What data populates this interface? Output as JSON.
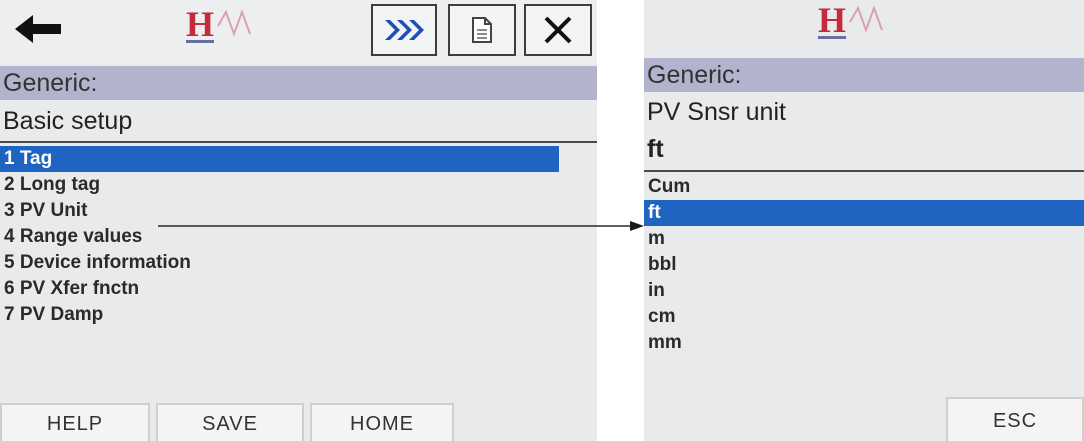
{
  "left_screen": {
    "header_band": "Generic:",
    "subtitle": "Basic setup",
    "menu_items": [
      {
        "label": "1 Tag",
        "selected": true
      },
      {
        "label": "2 Long tag",
        "selected": false
      },
      {
        "label": "3 PV Unit",
        "selected": false
      },
      {
        "label": "4 Range values",
        "selected": false
      },
      {
        "label": "5 Device information",
        "selected": false
      },
      {
        "label": "6 PV Xfer fnctn",
        "selected": false
      },
      {
        "label": "7 PV Damp",
        "selected": false
      }
    ],
    "buttons": {
      "help": "HELP",
      "save": "SAVE",
      "home": "HOME"
    },
    "icons": [
      "back-arrow-icon",
      "fast-forward-icon",
      "document-icon",
      "close-icon"
    ]
  },
  "right_screen": {
    "header_band": "Generic:",
    "variable_name": "PV Snsr unit",
    "current_value": "ft",
    "options": [
      {
        "label": "Cum",
        "selected": false
      },
      {
        "label": "ft",
        "selected": true
      },
      {
        "label": "m",
        "selected": false
      },
      {
        "label": "bbl",
        "selected": false
      },
      {
        "label": "in",
        "selected": false
      },
      {
        "label": "cm",
        "selected": false
      },
      {
        "label": "mm",
        "selected": false
      }
    ],
    "buttons": {
      "esc": "ESC"
    }
  },
  "logo": {
    "letter": "H"
  },
  "colors": {
    "selection": "#1e64c0",
    "header_band": "#b3b3ce",
    "logo_red": "#c32a3a",
    "arrow_blue": "#1e64c0"
  }
}
